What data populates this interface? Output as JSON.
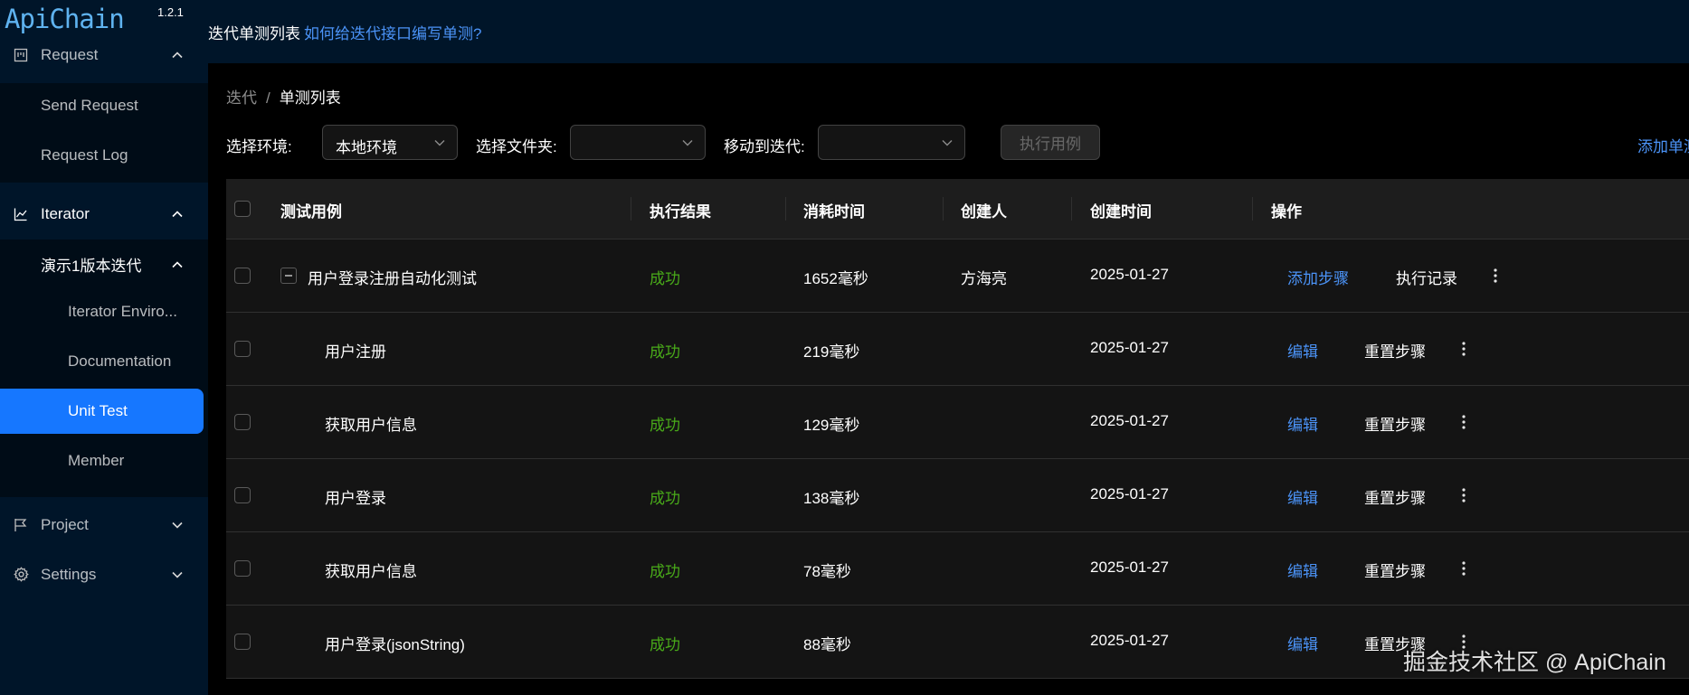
{
  "app": {
    "name": "ApiChain",
    "version": "1.2.1"
  },
  "sidebar": {
    "request": {
      "label": "Request",
      "items": [
        "Send Request",
        "Request Log"
      ]
    },
    "iterator": {
      "label": "Iterator",
      "group": {
        "label": "演示1版本迭代",
        "items": [
          "Iterator Enviro...",
          "Documentation",
          "Unit Test",
          "Member"
        ],
        "selected": "Unit Test"
      }
    },
    "project": {
      "label": "Project"
    },
    "settings": {
      "label": "Settings"
    }
  },
  "header": {
    "title": "迭代单测列表",
    "help_link": "如何给迭代接口编写单测?"
  },
  "breadcrumb": {
    "parent": "迭代",
    "separator": "/",
    "current": "单测列表"
  },
  "filters": {
    "env_label": "选择环境:",
    "env_value": "本地环境",
    "folder_label": "选择文件夹:",
    "folder_value": "",
    "move_label": "移动到迭代:",
    "move_value": "",
    "run_button": "执行用例",
    "add_link": "添加单测"
  },
  "table": {
    "columns": [
      "测试用例",
      "执行结果",
      "消耗时间",
      "创建人",
      "创建时间",
      "操作"
    ],
    "parent_row": {
      "name": "用户登录注册自动化测试",
      "result": "成功",
      "duration": "1652毫秒",
      "creator": "方海亮",
      "created": "2025-01-27",
      "action_primary": "添加步骤",
      "action_secondary": "执行记录"
    },
    "step_action_primary": "编辑",
    "step_action_secondary": "重置步骤",
    "steps": [
      {
        "name": "用户注册",
        "result": "成功",
        "duration": "219毫秒",
        "created": "2025-01-27"
      },
      {
        "name": "获取用户信息",
        "result": "成功",
        "duration": "129毫秒",
        "created": "2025-01-27"
      },
      {
        "name": "用户登录",
        "result": "成功",
        "duration": "138毫秒",
        "created": "2025-01-27"
      },
      {
        "name": "获取用户信息",
        "result": "成功",
        "duration": "78毫秒",
        "created": "2025-01-27"
      },
      {
        "name": "用户登录(jsonString)",
        "result": "成功",
        "duration": "88毫秒",
        "created": "2025-01-27"
      }
    ]
  },
  "watermark": "掘金技术社区 @ ApiChain",
  "colors": {
    "sidebar_bg": "#001529",
    "accent": "#1677ff",
    "link": "#4b93f7",
    "success": "#49aa19"
  }
}
